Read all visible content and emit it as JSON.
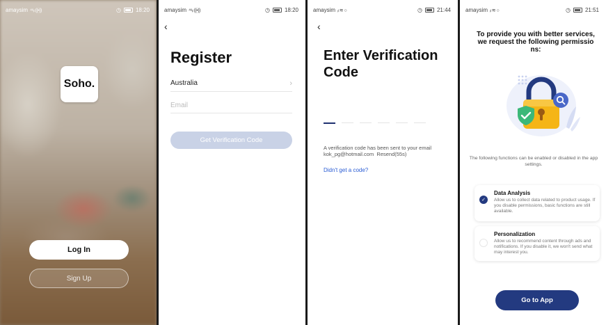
{
  "status_bar": {
    "carrier": "amaysim",
    "screens": [
      {
        "time": "18:20",
        "signal": "⁴⁶ᵢₗ ((•))"
      },
      {
        "time": "18:20",
        "signal": "⁴⁶ᵢₗ ((•))"
      },
      {
        "time": "21:44",
        "signal": "ᵢₗ ≋ ○"
      },
      {
        "time": "21:51",
        "signal": "ᵢₗ ≋ ○"
      }
    ]
  },
  "welcome": {
    "logo": "Soho.",
    "login_label": "Log In",
    "signup_label": "Sign Up"
  },
  "register": {
    "title": "Register",
    "country": "Australia",
    "email_placeholder": "Email",
    "email_value": "",
    "get_code_label": "Get Verification Code"
  },
  "verify": {
    "title": "Enter Verification Code",
    "code_length": 6,
    "message": "A verification code has been sent to your email kok_pg@hotmail.com",
    "resend": "Resend(55s)",
    "help_link": "Didn't get a code?"
  },
  "permissions": {
    "title": "To provide you with better services, we request the following permissio ns:",
    "description": "The following functions can be enabled or disabled in the app settings.",
    "items": [
      {
        "title": "Data Analysis",
        "text": "Allow us to collect data related to product usage. If you disable permissions, basic functions are still available.",
        "checked": true
      },
      {
        "title": "Personalization",
        "text": "Allow us to recommend content through ads and notifications. If you disable it, we won't send what may interest you.",
        "checked": false
      }
    ],
    "go_label": "Go to App"
  },
  "colors": {
    "primary": "#233a80",
    "disabled_button": "#c9d2e6",
    "link": "#2a5cd4",
    "lock_yellow": "#f5b516",
    "shield_green": "#3cb878"
  }
}
